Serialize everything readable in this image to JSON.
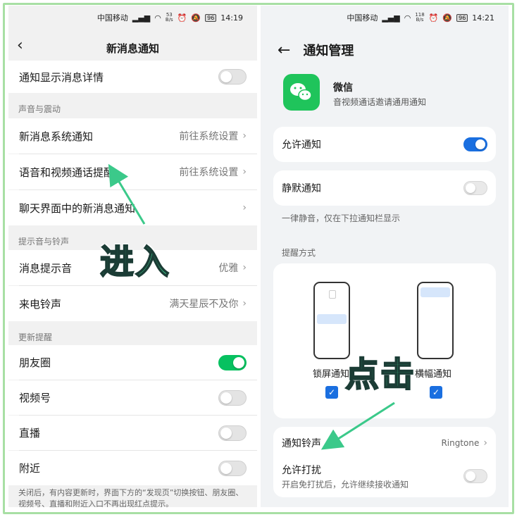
{
  "status": {
    "carrier": "中国移动",
    "speed_left": "53",
    "speed_right": "118",
    "speed_unit": "B/s",
    "battery": "96",
    "time_left": "14:19",
    "time_right": "14:21"
  },
  "left": {
    "title": "新消息通知",
    "rows": {
      "detail": "通知显示消息详情",
      "system": "新消息系统通知",
      "voice": "语音和视频通话提醒",
      "chat": "聊天界面中的新消息通知",
      "tone": "消息提示音",
      "ring": "来电铃声",
      "moments": "朋友圈",
      "channels": "视频号",
      "live": "直播",
      "nearby": "附近"
    },
    "values": {
      "go_system": "前往系统设置",
      "tone": "优雅",
      "ring": "满天星辰不及你"
    },
    "sections": {
      "sound": "声音与震动",
      "ringtone": "提示音与铃声",
      "update": "更新提醒"
    },
    "footnote": "关闭后，有内容更新时，界面下方的“发现页”切换按钮、朋友圈、视频号、直播和附近入口不再出现红点提示。",
    "toggles": {
      "detail": false,
      "moments": true,
      "channels": false,
      "live": false,
      "nearby": false
    }
  },
  "right": {
    "title": "通知管理",
    "app_name": "微信",
    "app_sub": "音视频通话邀请通用通知",
    "allow": "允许通知",
    "silent": "静默通知",
    "silent_note": "一律静音，仅在下拉通知栏显示",
    "remind_label": "提醒方式",
    "lock_label": "锁屏通知",
    "banner_label": "横幅通知",
    "ringtone": "通知铃声",
    "ringtone_value": "Ringtone",
    "disturb": "允许打扰",
    "disturb_sub": "开启免打扰后，允许继续接收通知",
    "toggles": {
      "allow": true,
      "silent": false,
      "disturb": false
    }
  },
  "annotations": {
    "enter": "进入",
    "click": "点击"
  },
  "colors": {
    "wechat_green": "#07c160",
    "accent_blue": "#1a6fe0",
    "annotation": "#3bc98a"
  }
}
